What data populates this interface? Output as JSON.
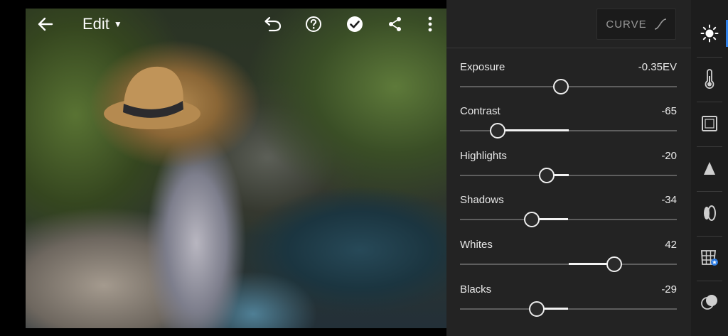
{
  "toolbar": {
    "edit_label": "Edit",
    "icons": [
      "back-arrow-icon",
      "undo-icon",
      "help-icon",
      "done-check-icon",
      "share-icon",
      "more-vertical-icon"
    ]
  },
  "panel": {
    "curve_label": "CURVE",
    "sliders": [
      {
        "label": "Exposure",
        "value": "-0.35EV",
        "position": 0.466
      },
      {
        "label": "Contrast",
        "value": "-65",
        "position": 0.175
      },
      {
        "label": "Highlights",
        "value": "-20",
        "position": 0.4
      },
      {
        "label": "Shadows",
        "value": "-34",
        "position": 0.33
      },
      {
        "label": "Whites",
        "value": "42",
        "position": 0.71
      },
      {
        "label": "Blacks",
        "value": "-29",
        "position": 0.355
      }
    ]
  },
  "side_tools": [
    "light-sun-icon",
    "color-thermometer-icon",
    "crop-icon",
    "detail-triangle-icon",
    "optics-icon",
    "geometry-grid-icon",
    "mask-circles-icon"
  ],
  "colors": {
    "accent": "#2f7fe6",
    "panel_bg": "#232323",
    "strip_bg": "#1d1d1d"
  }
}
